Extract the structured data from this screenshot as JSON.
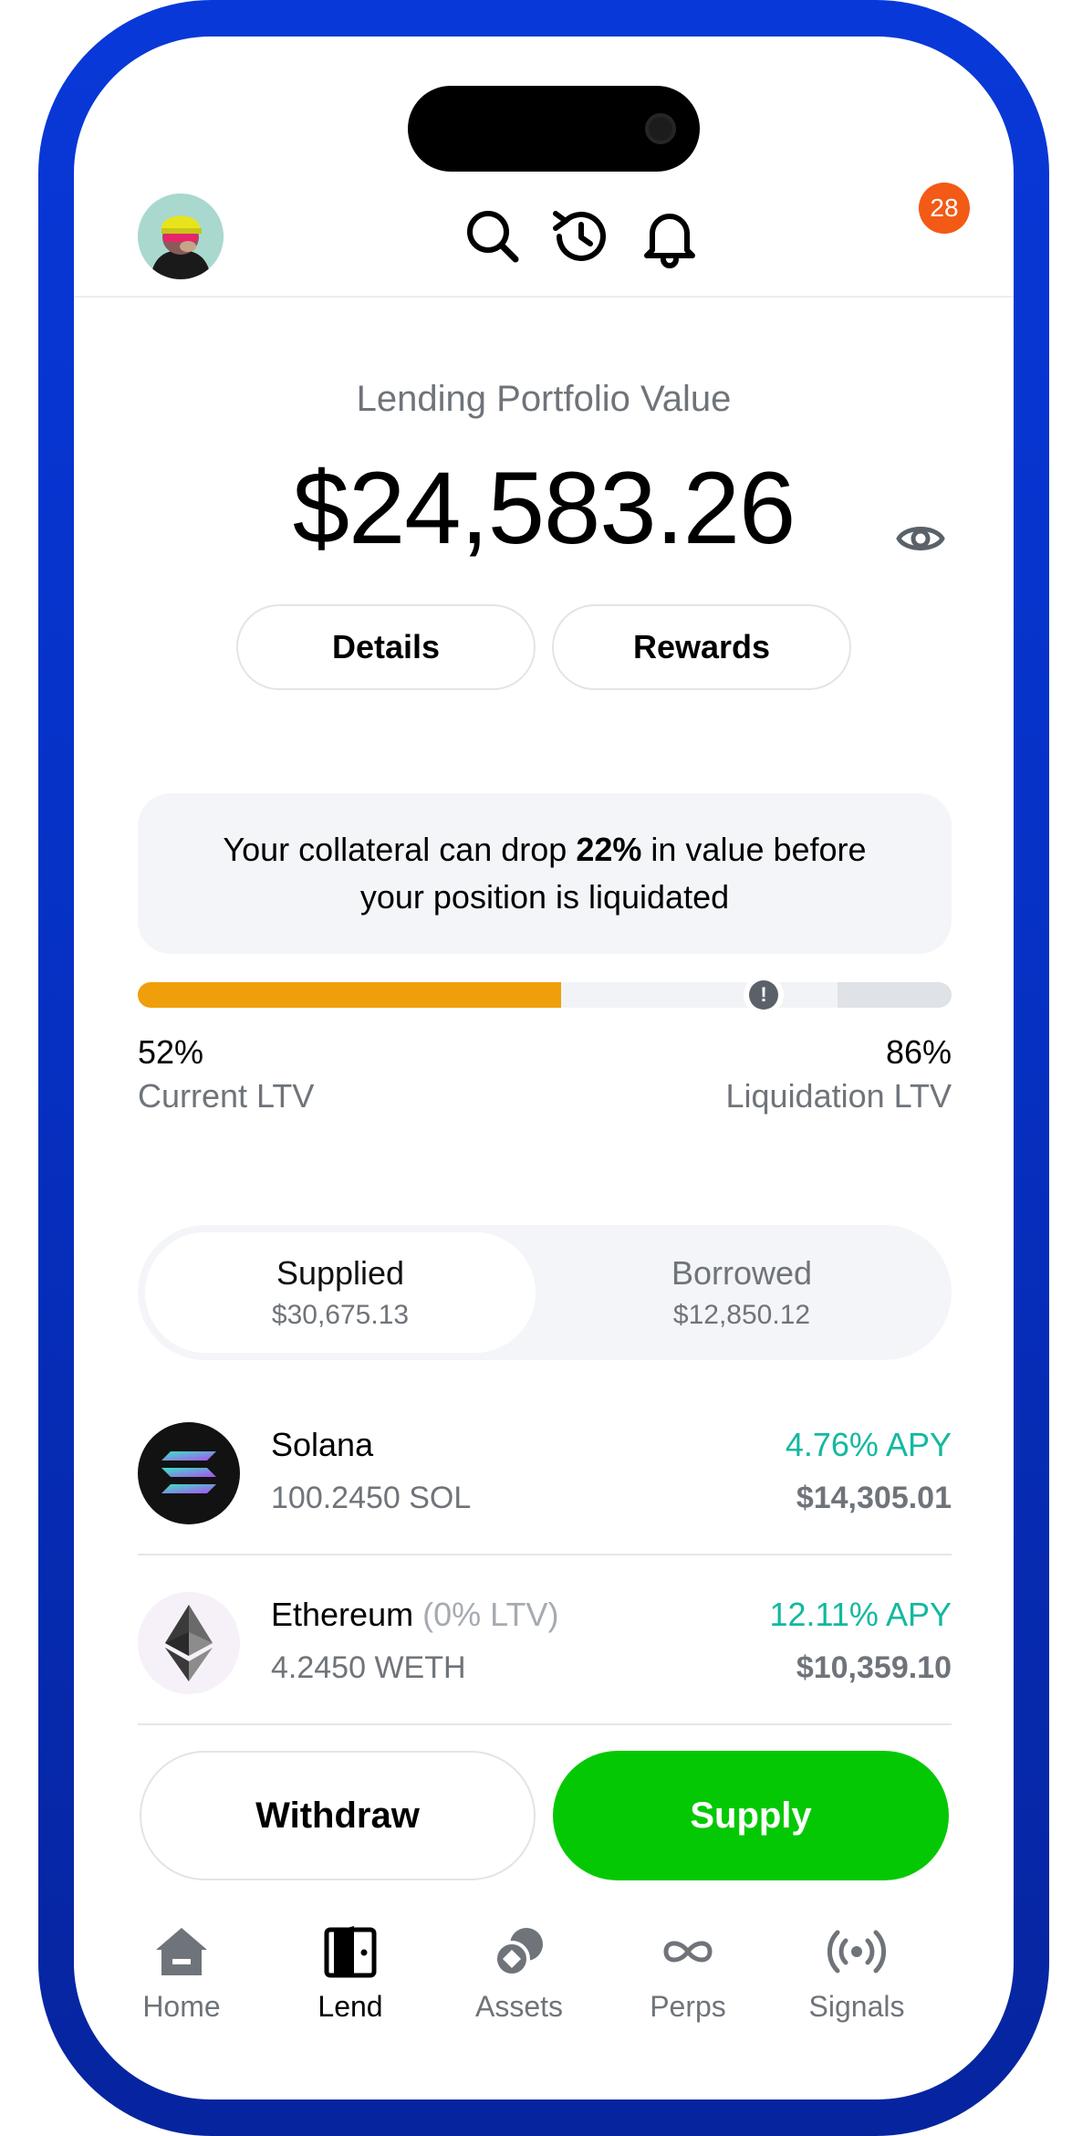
{
  "header": {
    "avatar": "avatar-icon",
    "icons": [
      "search-icon",
      "history-icon",
      "bell-icon"
    ],
    "notification_count": "28"
  },
  "portfolio": {
    "label": "Lending Portfolio Value",
    "value": "$24,583.26",
    "details_label": "Details",
    "rewards_label": "Rewards"
  },
  "collateral": {
    "text_before": "Your collateral can drop ",
    "drop_pct": "22%",
    "text_after": " in value before your position is liquidated"
  },
  "ltv": {
    "current_value": 52,
    "current_label": "52%",
    "current_caption": "Current LTV",
    "liquidation_value": 86,
    "liquidation_label": "86%",
    "liquidation_caption": "Liquidation LTV",
    "colors": {
      "fill": "#ef9f09",
      "track": "#f1f3f6",
      "tail": "#dfe2e6"
    }
  },
  "segments": [
    {
      "title": "Supplied",
      "value": "$30,675.13",
      "active": true
    },
    {
      "title": "Borrowed",
      "value": "$12,850.12",
      "active": false
    }
  ],
  "assets": [
    {
      "name": "Solana",
      "note": "",
      "amount": "100.2450 SOL",
      "apy": "4.76% APY",
      "usd": "$14,305.01",
      "icon": "solana-icon"
    },
    {
      "name": "Ethereum",
      "note": "(0% LTV)",
      "amount": "4.2450 WETH",
      "apy": "12.11% APY",
      "usd": "$10,359.10",
      "icon": "ethereum-icon"
    }
  ],
  "actions": {
    "withdraw": "Withdraw",
    "supply": "Supply",
    "supply_color": "#05c805"
  },
  "tabs": [
    {
      "label": "Home",
      "icon": "home-icon",
      "active": false
    },
    {
      "label": "Lend",
      "icon": "vault-icon",
      "active": true
    },
    {
      "label": "Assets",
      "icon": "assets-icon",
      "active": false
    },
    {
      "label": "Perps",
      "icon": "infinity-icon",
      "active": false
    },
    {
      "label": "Signals",
      "icon": "signal-icon",
      "active": false
    }
  ]
}
